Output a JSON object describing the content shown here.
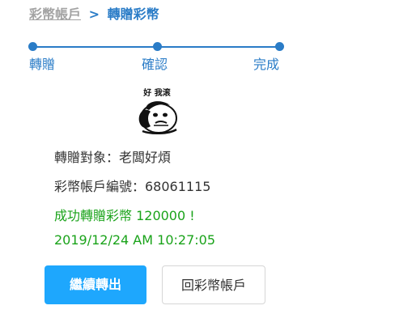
{
  "breadcrumb": {
    "parent": "彩幣帳戶",
    "separator": ">",
    "current": "轉贈彩幣"
  },
  "steps": [
    {
      "label": "轉贈"
    },
    {
      "label": "確認"
    },
    {
      "label": "完成"
    }
  ],
  "sticker": {
    "caption": "好 我滚"
  },
  "result": {
    "recipient": "轉贈對象：老闆好煩",
    "account": "彩幣帳戶編號：68061115",
    "success_message": "成功轉贈彩幣 120000 !",
    "timestamp": "2019/12/24 AM 10:27:05"
  },
  "buttons": {
    "continue_label": "繼續轉出",
    "back_label": "回彩幣帳戶"
  },
  "colors": {
    "accent": "#2a7cc7",
    "success": "#1aa31a",
    "primary_button": "#1ea7fd"
  }
}
